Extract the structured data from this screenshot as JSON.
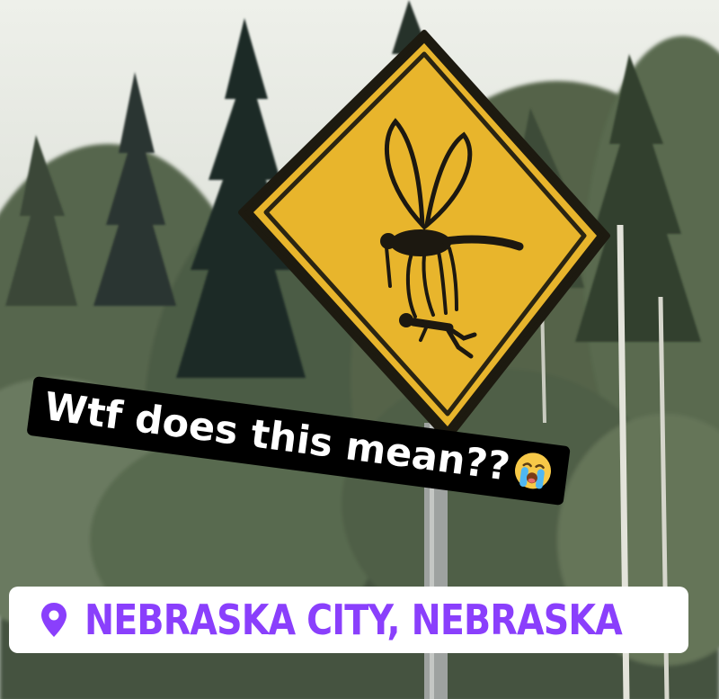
{
  "caption": {
    "text": "Wtf does this mean??",
    "emoji": "loudly-crying-face-emoji"
  },
  "location": {
    "text": "NEBRASKA CITY, NEBRASKA",
    "icon": "location-pin-icon"
  },
  "colors": {
    "sign_yellow": "#e8b52c",
    "sign_border": "#2a2412",
    "location_text": "#8a3ffc",
    "caption_bg": "#000000",
    "caption_text": "#ffffff"
  }
}
